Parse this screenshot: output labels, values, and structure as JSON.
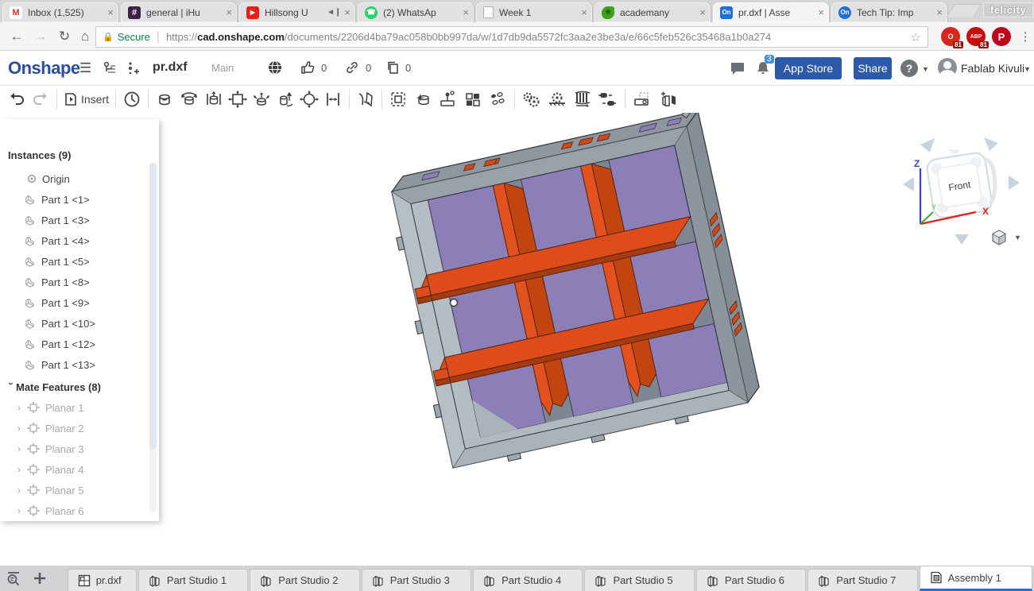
{
  "window": {
    "badge": "felicity"
  },
  "browser": {
    "tabs": [
      {
        "label": "Inbox (1,525)",
        "icon": "gmail"
      },
      {
        "label": "general | iHu",
        "icon": "slack"
      },
      {
        "label": "Hillsong U",
        "icon": "youtube",
        "audio": true
      },
      {
        "label": "(2) WhatsAp",
        "icon": "whatsapp"
      },
      {
        "label": "Week 1",
        "icon": "doc"
      },
      {
        "label": "academany",
        "icon": "academany"
      },
      {
        "label": "pr.dxf | Asse",
        "icon": "onshape",
        "active": true
      },
      {
        "label": "Tech Tip: Imp",
        "icon": "onshape"
      }
    ],
    "close_glyph": "×",
    "secure_label": "Secure",
    "url": {
      "scheme": "https://",
      "host": "cad.onshape.com",
      "path": "/documents/2206d4ba79ac058b0bb997da/w/1d7db9da5572fc3aa2e3be3a/e/66c5feb526c35468a1b0a274"
    },
    "extensions": {
      "onetab_badge": "81",
      "adblock_badge": "81",
      "adblock_label": "ABP",
      "pinterest_label": "P"
    }
  },
  "header": {
    "logo": "Onshape",
    "doc_title": "pr.dxf",
    "workspace": "Main",
    "likes": "0",
    "links": "0",
    "copies": "0",
    "notification_count": "3",
    "app_store_label": "App Store",
    "share_label": "Share",
    "help_label": "?",
    "user_name": "Fablab Kivuli"
  },
  "toolbar": {
    "insert_label": "Insert"
  },
  "panel": {
    "instances_title": "Instances (9)",
    "items": [
      "Origin",
      "Part 1 <1>",
      "Part 1 <3>",
      "Part 1 <4>",
      "Part 1 <5>",
      "Part 1 <8>",
      "Part 1 <9>",
      "Part 1 <10>",
      "Part 1 <12>",
      "Part 1 <13>"
    ],
    "mates_title": "Mate Features (8)",
    "mates": [
      "Planar 1",
      "Planar 2",
      "Planar 3",
      "Planar 4",
      "Planar 5",
      "Planar 6"
    ]
  },
  "viewport": {
    "viewcube_face": "Front",
    "axis_x": "X",
    "axis_y": "Y",
    "axis_z": "Z"
  },
  "bottom": {
    "tabs": [
      "pr.dxf",
      "Part Studio 1",
      "Part Studio 2",
      "Part Studio 3",
      "Part Studio 4",
      "Part Studio 5",
      "Part Studio 6",
      "Part Studio 7",
      "Assembly 1"
    ]
  },
  "colors": {
    "onshape_blue": "#2c5aa8",
    "active_tab_underline": "#2b6de0",
    "model_gray": "#9fa7b0",
    "model_purple": "#8c7eb7",
    "model_orange": "#de4b1c",
    "secure_green": "#0b8043"
  }
}
